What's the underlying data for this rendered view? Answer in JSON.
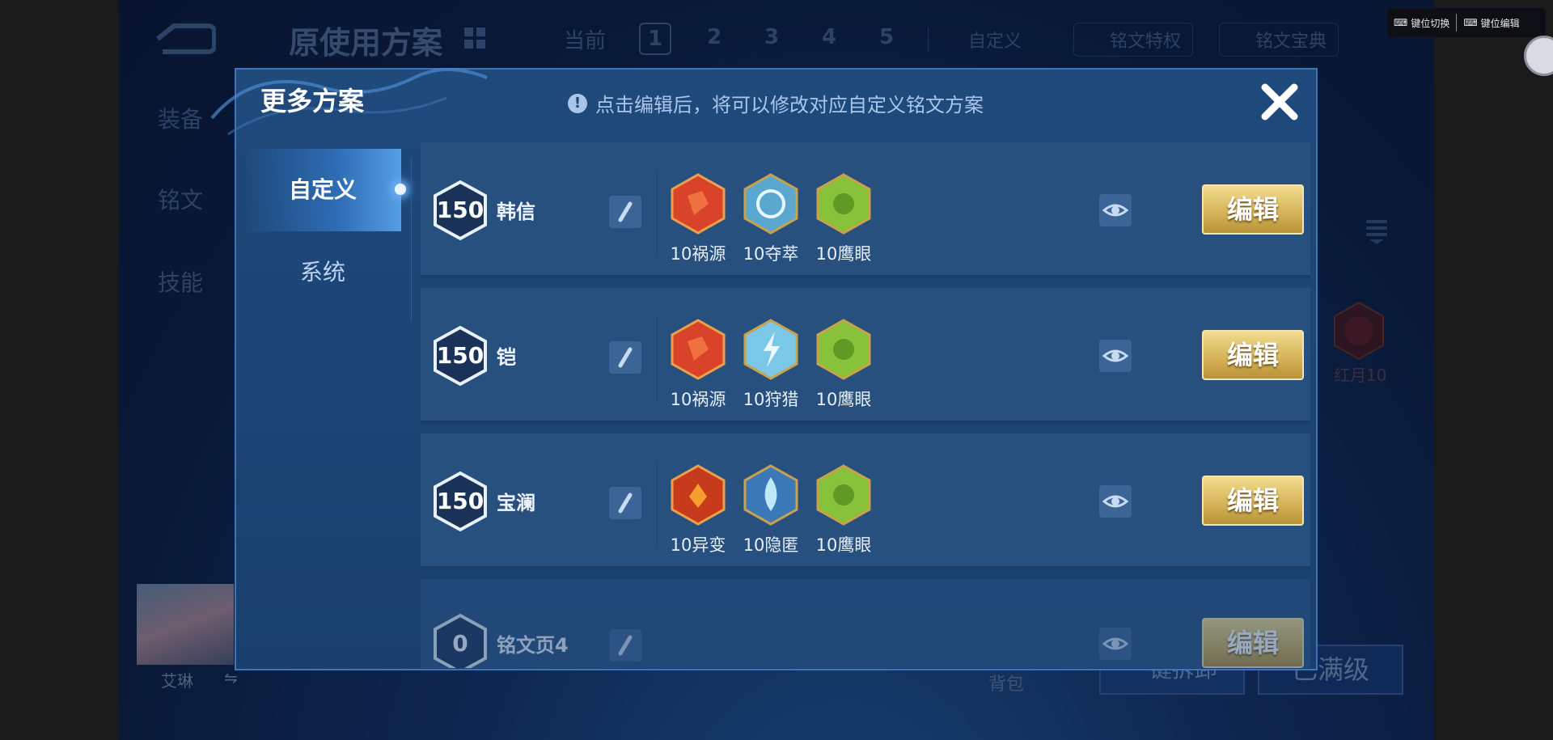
{
  "background": {
    "scheme_title": "原使用方案",
    "current_label": "当前",
    "pages": [
      "1",
      "2",
      "3",
      "4",
      "5"
    ],
    "custom_label": "自定义",
    "privilege_label": "铭文特权",
    "codex_label": "铭文宝典",
    "side_nav": [
      "装备",
      "铭文",
      "技能"
    ],
    "hongyue_label": "红月10",
    "hero_name": "艾琳",
    "swap_icon": "⇋",
    "bag_label": "背包",
    "btn_left_label": "一键拆卸",
    "btn_right_label": "已满级"
  },
  "emulator": {
    "key_switch": "键位切换",
    "key_edit": "键位编辑"
  },
  "modal": {
    "title": "更多方案",
    "hint": "点击编辑后，将可以修改对应自定义铭文方案",
    "hint_icon": "!",
    "tabs": [
      {
        "label": "自定义",
        "active": true
      },
      {
        "label": "系统",
        "active": false
      }
    ],
    "edit_label": "编辑",
    "rows": [
      {
        "level": "150",
        "name": "韩信",
        "runes": [
          {
            "label": "10祸源",
            "icon": "red-rune-icon"
          },
          {
            "label": "10夺萃",
            "icon": "blue-rune-icon"
          },
          {
            "label": "10鹰眼",
            "icon": "green-rune-icon"
          }
        ]
      },
      {
        "level": "150",
        "name": "铠",
        "runes": [
          {
            "label": "10祸源",
            "icon": "red-rune-icon"
          },
          {
            "label": "10狩猎",
            "icon": "blue-rune-icon"
          },
          {
            "label": "10鹰眼",
            "icon": "green-rune-icon"
          }
        ]
      },
      {
        "level": "150",
        "name": "宝澜",
        "runes": [
          {
            "label": "10异变",
            "icon": "red-rune-icon"
          },
          {
            "label": "10隐匿",
            "icon": "blue-rune-icon"
          },
          {
            "label": "10鹰眼",
            "icon": "green-rune-icon"
          }
        ]
      },
      {
        "level": "0",
        "name": "铭文页4",
        "runes": []
      }
    ]
  },
  "colors": {
    "red_rune": "#d8432a",
    "blue_rune": "#7cc8e8",
    "green_rune": "#88c23a",
    "gold_button": "#d6b45a"
  }
}
